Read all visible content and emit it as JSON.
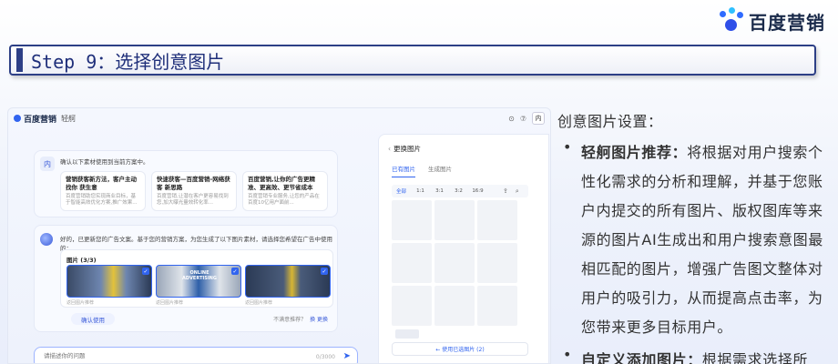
{
  "brand": {
    "name": "百度营销"
  },
  "step": {
    "title": "Step 9：选择创意图片"
  },
  "app": {
    "logo": "百度营销",
    "sub": "轻舸",
    "header_icons": [
      "⊙",
      "⑦"
    ],
    "avatar": "内",
    "msg1": {
      "badge": "内",
      "text": "确认以下素材使用到当前方案中。",
      "choices": [
        {
          "title": "营销获客新方法，客户主动找你 获生意",
          "desc": "百度营销助您实现商业目标，基于智能高效优化方案,推广效果..."
        },
        {
          "title": "快速获客—百度营销-网络获客 新思路",
          "desc": "百度营销,让潜在客户更容易找到您,加大曝光量效转化率..."
        },
        {
          "title": "百度营销,让你的广告更精准、更高效、更节省成本",
          "desc": "百度营销专业服务,让您的产品在百度10亿用户面前..."
        }
      ]
    },
    "msg2": {
      "text": "好的，已更新您的广告文案。基于您的营销方案，为您生成了以下图片素材，请选择您希望在广告中使用的：",
      "images_label": "图片 (3/3)",
      "captions": [
        "返回图片推荐",
        "返回图片推荐",
        "返回图片推荐"
      ],
      "thumb_banner": "ONLINE ADVERTISING",
      "confirm": "确认使用",
      "not_satisfied": "不满意推荐？",
      "change": "换 更换"
    },
    "input": {
      "placeholder": "请描述你的问题",
      "count": "0/3000",
      "send": "➤"
    },
    "panel": {
      "back": "‹",
      "title": "更换图片",
      "tabs": [
        "已有图片",
        "生成图片"
      ],
      "ratios": [
        "全部",
        "1:1",
        "3:1",
        "3:2",
        "16:9"
      ],
      "use_button": "← 使用已选图片 (2)"
    }
  },
  "desc": {
    "title": "创意图片设置：",
    "bullets": [
      {
        "label": "轻舸图片推荐：",
        "text": "将根据对用户搜索个性化需求的分析和理解，并基于您账户内提交的所有图片、版权图库等来源的图片AI生成出和用户搜索意图最相匹配的图片，增强广告图文整体对用户的吸引力，从而提高点击率，为您带来更多目标用户。"
      },
      {
        "label": "自定义添加图片：",
        "text": "根据需求选择所"
      }
    ]
  },
  "colors": {
    "accent": "#3164ef",
    "title_bar": "#2d3f86"
  }
}
